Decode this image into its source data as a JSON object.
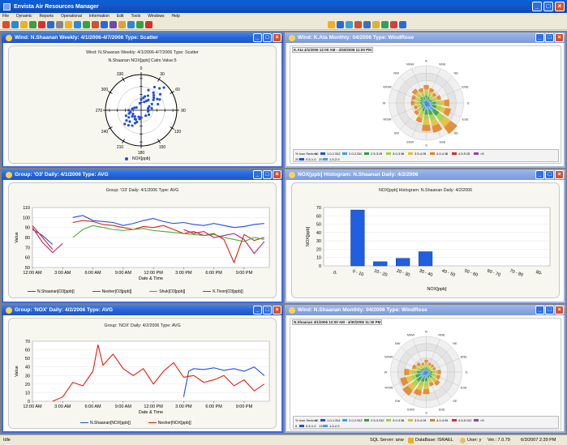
{
  "app": {
    "title": "Envista Air Resources Manager"
  },
  "menu": [
    "File",
    "Dynamic",
    "Reports",
    "Operational",
    "Information",
    "Edit",
    "Tools",
    "Windows",
    "Help"
  ],
  "windows": {
    "scatter": {
      "title": "Wind: N.Shaanan  Weekly: 4/1/2006-4/7/2006  Type: Scatter",
      "heading": "Wind: N.Shaanan Weekly: 4/1/2006-4/7/2006 Type: Scatter",
      "subheading": "N.Shaanan NOX[ppb]   Calm Value:5",
      "legend": "NOX[ppb]"
    },
    "rose1": {
      "title": "Wind: K.Ata  Monthly: 04/2006  Type: WindRose",
      "caption": "K.Ata 4/1/2006 12:00 AM - 4/30/2006 11:00 PM",
      "table_row1": [
        "% Icon Sectors",
        "10",
        "1.0-1.5",
        "12",
        "2.0-2.5",
        "11",
        "2.5-3.0",
        "9",
        "3.0-3.5",
        "6",
        "3.5-4.0",
        "9",
        "4.0-4.5",
        "8",
        "4.5-5.0",
        "3",
        ">5"
      ],
      "table_row2": [
        "20",
        "0.5-1.0",
        "20",
        "1.5-2.0"
      ]
    },
    "o3": {
      "title": "Group: 'O3' Daily: 4/1/2006  Type: AVG",
      "heading": "Group: 'O3' Daily: 4/1/2006  Type: AVG"
    },
    "hist": {
      "title": "NOX[ppb] Histogram: N.Shaanan  Daily: 4/2/2006",
      "heading": "NOX[ppb] Histogram: N.Shaanan  Daily: 4/2/2006"
    },
    "nox": {
      "title": "Group: 'NOX' Daily: 4/2/2006  Type: AVG",
      "heading": "Group: 'NOX' Daily: 4/2/2006  Type: AVG"
    },
    "rose2": {
      "title": "Wind: N.Shaanan  Monthly: 04/2006  Type: WindRose",
      "caption": "N.Shaanan 4/1/2006 12:00 AM - 4/30/2006 11:30 PM",
      "table_row1": [
        "% Icon Sectors",
        "10",
        "1.0-1.5",
        "14",
        "2.0-2.5",
        "13",
        "2.5-3.0",
        "12",
        "3.0-3.5",
        "8",
        "3.5-4.0",
        "4",
        "4.0-4.5",
        "4",
        "4.5-5.0",
        "12",
        ">5"
      ],
      "table_row2": [
        "6",
        "0.5-1.0",
        "13",
        "1.5-2.0"
      ]
    }
  },
  "rose_directions": [
    "N",
    "NNE",
    "NE",
    "ENE",
    "E",
    "ESE",
    "SE",
    "SSE",
    "S",
    "SSW",
    "SW",
    "WSW",
    "W",
    "WNW",
    "NW",
    "NNW"
  ],
  "status": {
    "left": "Idle",
    "server": "SQL Server: anw",
    "database": "DataBase: ISRAEL",
    "user": "User: y",
    "version": "Ver.: 7.0.79",
    "datetime": "6/3/2007 2:39 PM"
  },
  "colors": {
    "blue": "#1f4fe0",
    "red": "#e02010",
    "green": "#49b030",
    "magenta": "#c02070"
  },
  "chart_data": [
    {
      "type": "scatter",
      "title": "Wind: N.Shaanan Weekly: 4/1/2006-4/7/2006 Type: Scatter",
      "subtitle": "N.Shaanan NOX[ppb]   Calm Value:5",
      "polar": true,
      "angle_ticks": [
        330,
        0,
        30,
        60,
        90,
        120,
        150,
        180,
        210,
        240,
        270,
        300
      ],
      "series": [
        {
          "name": "NOX[ppb]",
          "points_deg_r": [
            [
              40,
              0.8
            ],
            [
              45,
              0.9
            ],
            [
              50,
              0.7
            ],
            [
              35,
              0.6
            ],
            [
              30,
              0.75
            ],
            [
              20,
              0.6
            ],
            [
              55,
              0.55
            ],
            [
              60,
              0.6
            ],
            [
              70,
              0.5
            ],
            [
              25,
              0.45
            ],
            [
              15,
              0.4
            ],
            [
              10,
              0.35
            ],
            [
              0,
              0.3
            ],
            [
              350,
              0.2
            ],
            [
              80,
              0.3
            ],
            [
              100,
              0.2
            ],
            [
              120,
              0.25
            ],
            [
              140,
              0.2
            ],
            [
              200,
              0.35
            ],
            [
              210,
              0.5
            ],
            [
              220,
              0.55
            ],
            [
              225,
              0.45
            ],
            [
              230,
              0.6
            ],
            [
              235,
              0.5
            ],
            [
              240,
              0.4
            ],
            [
              250,
              0.45
            ],
            [
              255,
              0.35
            ],
            [
              260,
              0.3
            ],
            [
              270,
              0.35
            ],
            [
              280,
              0.25
            ],
            [
              290,
              0.2
            ],
            [
              300,
              0.15
            ],
            [
              200,
              0.2
            ],
            [
              190,
              0.25
            ],
            [
              180,
              0.2
            ],
            [
              45,
              0.5
            ],
            [
              40,
              0.55
            ],
            [
              50,
              0.45
            ],
            [
              35,
              0.35
            ],
            [
              60,
              0.35
            ],
            [
              30,
              0.3
            ],
            [
              20,
              0.25
            ],
            [
              65,
              0.25
            ],
            [
              75,
              0.2
            ],
            [
              215,
              0.3
            ],
            [
              225,
              0.25
            ],
            [
              235,
              0.3
            ],
            [
              245,
              0.25
            ],
            [
              205,
              0.4
            ],
            [
              210,
              0.3
            ]
          ]
        }
      ]
    },
    {
      "type": "line",
      "title": "Group: 'O3' Daily: 4/1/2006  Type: AVG",
      "xlabel": "Date & Time",
      "ylabel": "Value",
      "x_ticks": [
        "12:00 AM",
        "3:00 AM",
        "6:00 AM",
        "9:00 AM",
        "12:00 PM",
        "3:00 PM",
        "6:00 PM",
        "9:00 PM"
      ],
      "ylim": [
        50,
        110
      ],
      "y_ticks": [
        50,
        60,
        70,
        80,
        90,
        100,
        110
      ],
      "x_hours": [
        0,
        1,
        2,
        3,
        4,
        5,
        6,
        7,
        8,
        9,
        10,
        11,
        12,
        13,
        14,
        15,
        16,
        17,
        18,
        19,
        20,
        21,
        22,
        23
      ],
      "series": [
        {
          "name": "N.Shaanan[O3[ppb]]",
          "color": "#1f4fe0",
          "values": [
            88,
            82,
            73,
            null,
            100,
            102,
            97,
            96,
            95,
            92,
            94,
            97,
            99,
            96,
            94,
            95,
            93,
            92,
            94,
            92,
            90,
            91,
            93,
            94
          ]
        },
        {
          "name": "Nesher[O3[ppb]]",
          "color": "#e02010",
          "values": [
            92,
            80,
            68,
            null,
            95,
            97,
            96,
            93,
            92,
            90,
            88,
            91,
            90,
            92,
            88,
            84,
            86,
            82,
            84,
            78,
            55,
            83,
            77,
            80
          ]
        },
        {
          "name": "Shuk[O3[ppb]]",
          "color": "#49b030",
          "values": [
            null,
            null,
            null,
            null,
            80,
            88,
            92,
            90,
            88,
            87,
            88,
            89,
            87,
            86,
            85,
            84,
            83,
            82,
            83,
            80,
            78,
            76,
            80,
            78
          ]
        },
        {
          "name": "K.Tivon[O3[ppb]]",
          "color": "#c02070",
          "values": [
            90,
            75,
            65,
            74,
            null,
            null,
            null,
            null,
            null,
            null,
            null,
            null,
            null,
            null,
            null,
            88,
            84,
            86,
            80,
            82,
            84,
            78,
            64,
            76
          ]
        }
      ]
    },
    {
      "type": "bar",
      "title": "NOX[ppb] Histogram: N.Shaanan  Daily: 4/2/2006",
      "xlabel": "NOX[ppb]",
      "ylabel": "NOX[ppb]",
      "categories": [
        "0-",
        "0 - 10",
        "10 - 20",
        "20 - 30",
        "30 - 40",
        "40 - 50",
        "50 - 60",
        "60 - 70",
        "70 - 80",
        "80-"
      ],
      "values": [
        0,
        67,
        5,
        9,
        17,
        0,
        0,
        0,
        0,
        0
      ],
      "ylim": [
        0,
        70
      ],
      "y_ticks": [
        0,
        10,
        20,
        30,
        40,
        50,
        60,
        70
      ]
    },
    {
      "type": "line",
      "title": "Group: 'NOX' Daily: 4/2/2006  Type: AVG",
      "xlabel": "Date & Time",
      "ylabel": "Value",
      "x_ticks": [
        "12:00 AM",
        "3:00 AM",
        "6:00 AM",
        "9:00 AM",
        "12:00 PM",
        "3:00 PM",
        "6:00 PM",
        "9:00 PM"
      ],
      "ylim": [
        0,
        70
      ],
      "y_ticks": [
        0,
        10,
        20,
        30,
        40,
        50,
        60,
        70
      ],
      "series": [
        {
          "name": "N.Shaanan[NOX[ppb]]",
          "color": "#1f4fe0",
          "x_hours": [
            15,
            15.5,
            16,
            17,
            18,
            19,
            20,
            21,
            22,
            23
          ],
          "values": [
            5,
            35,
            38,
            37,
            39,
            36,
            38,
            35,
            40,
            30
          ]
        },
        {
          "name": "Nesher[NOX[ppb]]",
          "color": "#e02010",
          "x_hours": [
            2,
            3,
            4,
            5,
            6,
            6.5,
            7,
            8,
            9,
            10,
            11,
            12,
            13,
            14,
            15,
            16,
            17,
            18,
            19,
            20,
            21,
            22,
            23
          ],
          "values": [
            0,
            5,
            22,
            18,
            35,
            66,
            42,
            55,
            38,
            30,
            38,
            20,
            35,
            45,
            28,
            30,
            22,
            25,
            30,
            18,
            25,
            12,
            20
          ]
        }
      ]
    }
  ]
}
